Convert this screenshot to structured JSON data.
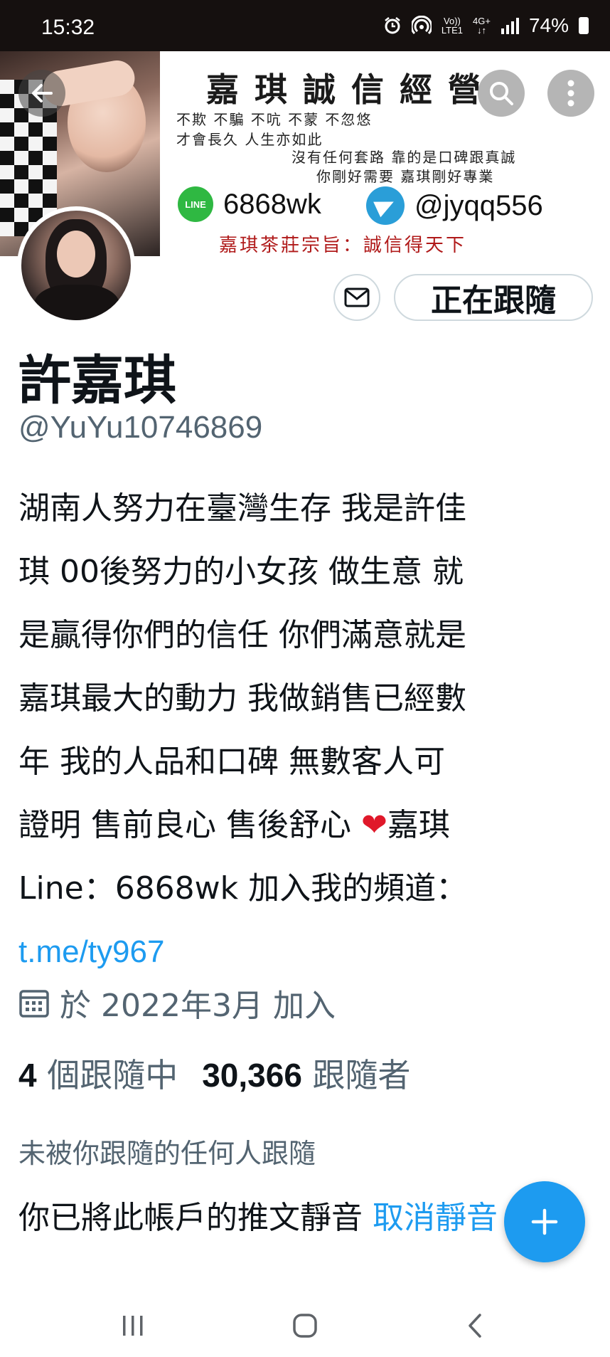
{
  "status_bar": {
    "time": "15:32",
    "volte": "Vo))",
    "lte": "LTE1",
    "net": "4G+",
    "battery": "74%",
    "icons": [
      "alarm-icon",
      "hotspot-icon",
      "volte-icon",
      "4g-icon",
      "signal-icon",
      "battery-icon"
    ]
  },
  "banner": {
    "title": "嘉琪誠信經營",
    "lines": [
      "不欺 不騙 不吭 不蒙 不忽悠",
      "才會長久 人生亦如此",
      "沒有任何套路 靠的是口碑跟真誠",
      "你剛好需要 嘉琪剛好專業"
    ],
    "line_badge": "LINE",
    "line_id": "6868wk",
    "telegram_id": "@jyqq556",
    "motto": "嘉琪茶莊宗旨：誠信得天下"
  },
  "header_buttons": {
    "back": "back-arrow-icon",
    "search": "search-icon",
    "more": "more-vertical-icon"
  },
  "profile": {
    "display_name": "許嘉琪",
    "handle": "@YuYu10746869",
    "bio_lines": [
      "湖南人努力在臺灣生存 我是許佳",
      "琪 00後努力的小女孩 做生意 就",
      "是贏得你們的信任 你們滿意就是",
      "嘉琪最大的動力 我做銷售已經數",
      "年 我的人品和口碑 無數客人可"
    ],
    "bio_line6_a": "證明 售前良心 售後舒心 ",
    "bio_heart": "❤",
    "bio_line6_b": "嘉琪",
    "bio_line7": "Line：6868wk 加入我的頻道：",
    "bio_link": "t.me/ty967",
    "joined": "於 2022年3月 加入",
    "following_count": "4",
    "following_label": "個跟隨中",
    "followers_count": "30,366",
    "followers_label": "跟隨者",
    "not_followed_text": "未被你跟隨的任何人跟隨",
    "muted_text": "你已將此帳戶的推文靜音 ",
    "unmute_label": "取消靜音"
  },
  "actions": {
    "message_icon": "mail-icon",
    "follow_label": "正在跟隨"
  },
  "fab": {
    "icon": "plus-icon"
  },
  "nav": [
    "recent-apps-icon",
    "home-icon",
    "back-icon"
  ],
  "colors": {
    "accent": "#1d9bf0",
    "text": "#0f1419",
    "secondary": "#536471",
    "status_bar": "#15100f",
    "heart": "#e0182a"
  }
}
